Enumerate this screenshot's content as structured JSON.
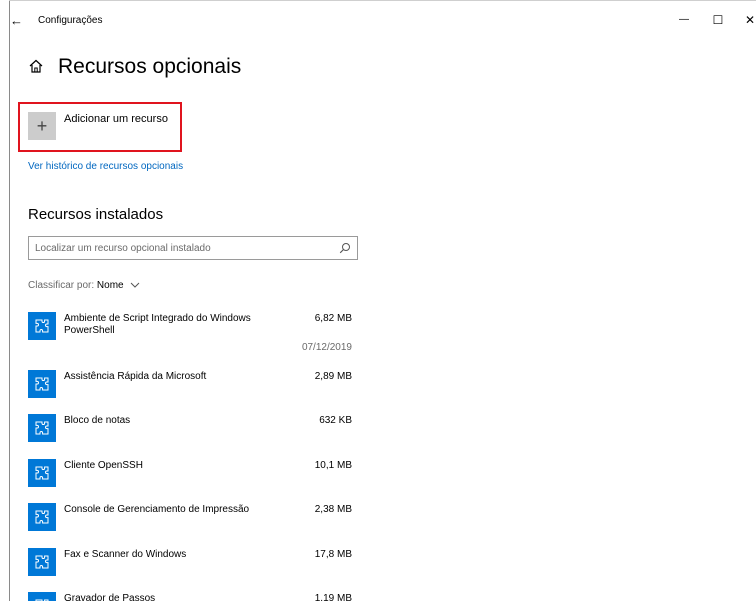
{
  "window": {
    "title": "Configurações",
    "back_glyph": "←",
    "min_glyph": "—",
    "max_glyph": "☐",
    "close_glyph": "✕"
  },
  "page": {
    "title": "Recursos opcionais",
    "home_icon": "home-icon"
  },
  "add_feature": {
    "label": "Adicionar um recurso",
    "icon": "plus-icon",
    "highlight_color": "#e0141e"
  },
  "history_link": "Ver histórico de recursos opcionais",
  "installed": {
    "title": "Recursos instalados",
    "search_placeholder": "Localizar um recurso opcional instalado",
    "search_value": "",
    "sort_label": "Classificar por:",
    "sort_value": "Nome",
    "items": [
      {
        "name": "Ambiente de Script Integrado do Windows PowerShell",
        "size": "6,82 MB",
        "date": "07/12/2019"
      },
      {
        "name": "Assistência Rápida da Microsoft",
        "size": "2,89 MB",
        "date": ""
      },
      {
        "name": "Bloco de notas",
        "size": "632 KB",
        "date": ""
      },
      {
        "name": "Cliente OpenSSH",
        "size": "10,1 MB",
        "date": ""
      },
      {
        "name": "Console de Gerenciamento de Impressão",
        "size": "2,38 MB",
        "date": ""
      },
      {
        "name": "Fax e Scanner do Windows",
        "size": "17,8 MB",
        "date": ""
      },
      {
        "name": "Gravador de Passos",
        "size": "1,19 MB",
        "date": ""
      }
    ]
  },
  "colors": {
    "accent": "#0078d7",
    "link": "#0067c0"
  }
}
